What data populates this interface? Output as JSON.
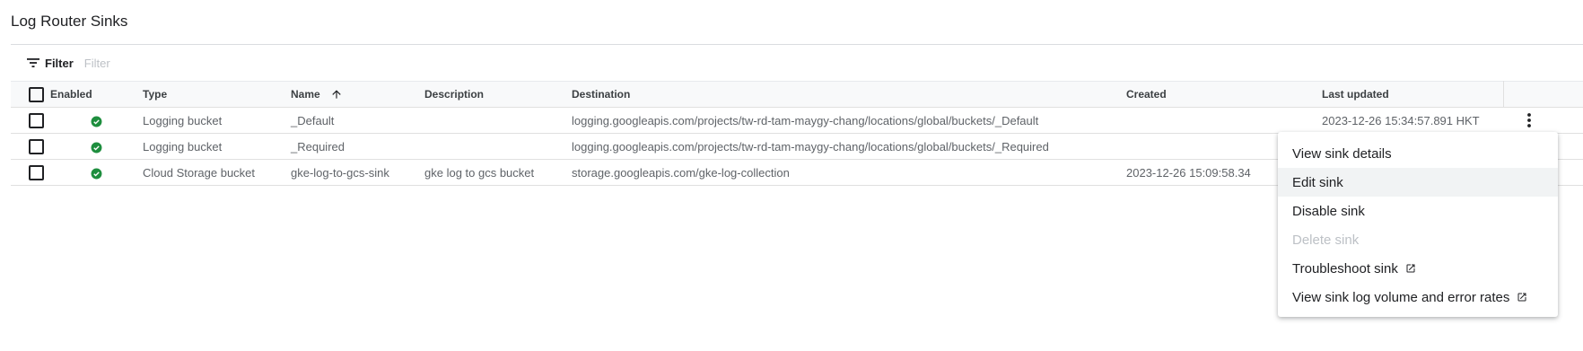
{
  "page": {
    "title": "Log Router Sinks"
  },
  "filter": {
    "button_label": "Filter",
    "placeholder": "Filter",
    "value": ""
  },
  "table": {
    "columns": {
      "enabled": "Enabled",
      "type": "Type",
      "name": "Name",
      "description": "Description",
      "destination": "Destination",
      "created": "Created",
      "last_updated": "Last updated"
    },
    "sort": {
      "column": "name",
      "direction": "ascending",
      "icon": "arrow-up-icon"
    },
    "rows": [
      {
        "enabled": true,
        "status_icon": "check-circle-icon",
        "type": "Logging bucket",
        "name": "_Default",
        "description": "",
        "destination": "logging.googleapis.com/projects/tw-rd-tam-maygy-chang/locations/global/buckets/_Default",
        "created": "",
        "last_updated": "2023-12-26 15:34:57.891 HKT"
      },
      {
        "enabled": true,
        "status_icon": "check-circle-icon",
        "type": "Logging bucket",
        "name": "_Required",
        "description": "",
        "destination": "logging.googleapis.com/projects/tw-rd-tam-maygy-chang/locations/global/buckets/_Required",
        "created": "",
        "last_updated": ""
      },
      {
        "enabled": true,
        "status_icon": "check-circle-icon",
        "type": "Cloud Storage bucket",
        "name": "gke-log-to-gcs-sink",
        "description": "gke log to gcs bucket",
        "destination": "storage.googleapis.com/gke-log-collection",
        "created": "2023-12-26 15:09:58.34",
        "last_updated": ""
      }
    ]
  },
  "context_menu": {
    "items": [
      {
        "label": "View sink details",
        "state": "normal"
      },
      {
        "label": "Edit sink",
        "state": "hover"
      },
      {
        "label": "Disable sink",
        "state": "normal"
      },
      {
        "label": "Delete sink",
        "state": "disabled"
      },
      {
        "label": "Troubleshoot sink",
        "state": "normal",
        "icon": "open-in-new-icon"
      },
      {
        "label": "View sink log volume and error rates",
        "state": "normal",
        "icon": "open-in-new-icon"
      }
    ]
  },
  "colors": {
    "enabled_green": "#1e8e3e",
    "header_bg": "#f8f9fa",
    "menu_hover_bg": "#f1f3f4",
    "disabled_text": "#bdc1c6"
  }
}
